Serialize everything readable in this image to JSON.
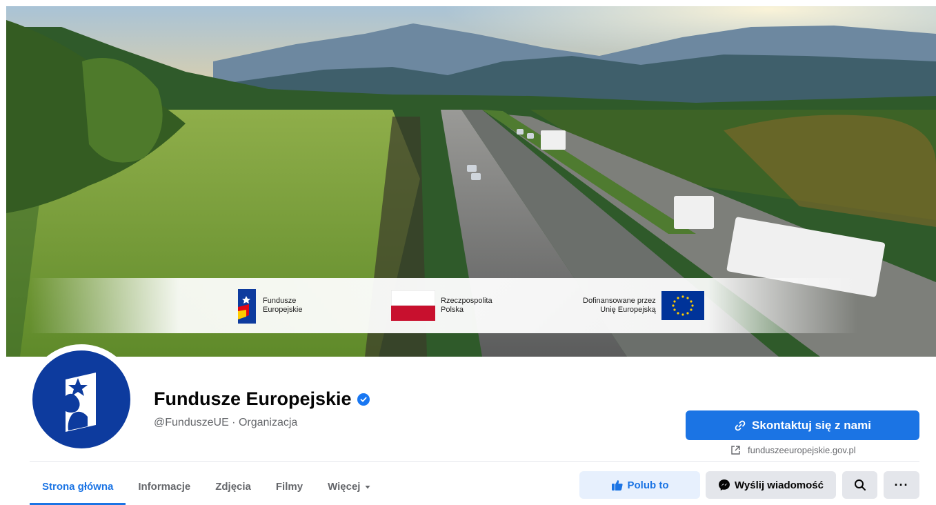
{
  "cover": {
    "banner": {
      "fe_line1": "Fundusze",
      "fe_line2": "Europejskie",
      "pl_line1": "Rzeczpospolita",
      "pl_line2": "Polska",
      "eu_line1": "Dofinansowane przez",
      "eu_line2": "Unię Europejską"
    }
  },
  "profile": {
    "name": "Fundusze Europejskie",
    "handle": "@FunduszeUE · Organizacja",
    "verified": true
  },
  "actions": {
    "contact_label": "Skontaktuj się z nami",
    "website": "funduszeeuropejskie.gov.pl",
    "like_label": "Polub to",
    "message_label": "Wyślij wiadomość",
    "more_label": "···"
  },
  "tabs": [
    {
      "label": "Strona główna",
      "active": true
    },
    {
      "label": "Informacje",
      "active": false
    },
    {
      "label": "Zdjęcia",
      "active": false
    },
    {
      "label": "Filmy",
      "active": false
    },
    {
      "label": "Więcej",
      "active": false
    }
  ],
  "colors": {
    "accent": "#1b74e4",
    "brand_navy": "#0d3b9e",
    "muted_text": "#65676b"
  },
  "icons": [
    "verified-badge-icon",
    "link-icon",
    "external-link-icon",
    "thumbs-up-icon",
    "messenger-icon",
    "search-icon",
    "more-icon",
    "caret-down-icon"
  ]
}
